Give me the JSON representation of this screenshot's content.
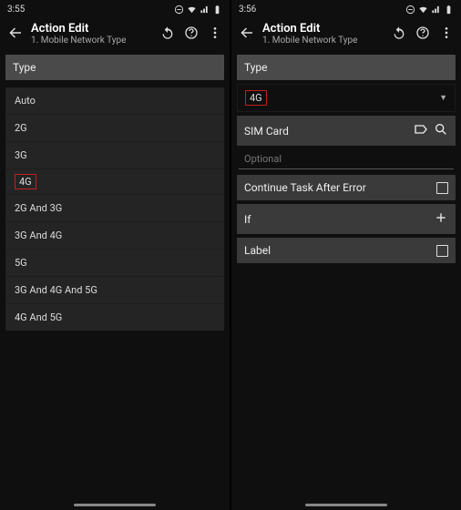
{
  "left": {
    "status": {
      "time": "3:55"
    },
    "header": {
      "title": "Action Edit",
      "subtitle": "1. Mobile Network Type"
    },
    "type_label": "Type",
    "options": [
      "Auto",
      "2G",
      "3G",
      "4G",
      "2G And 3G",
      "3G And 4G",
      "5G",
      "3G And 4G And 5G",
      "4G And 5G"
    ],
    "highlight_index": 3
  },
  "right": {
    "status": {
      "time": "3:56"
    },
    "header": {
      "title": "Action Edit",
      "subtitle": "1. Mobile Network Type"
    },
    "type_label": "Type",
    "type_value": "4G",
    "simcard_label": "SIM Card",
    "optional_placeholder": "Optional",
    "continue_label": "Continue Task After Error",
    "if_label": "If",
    "label_label": "Label"
  }
}
